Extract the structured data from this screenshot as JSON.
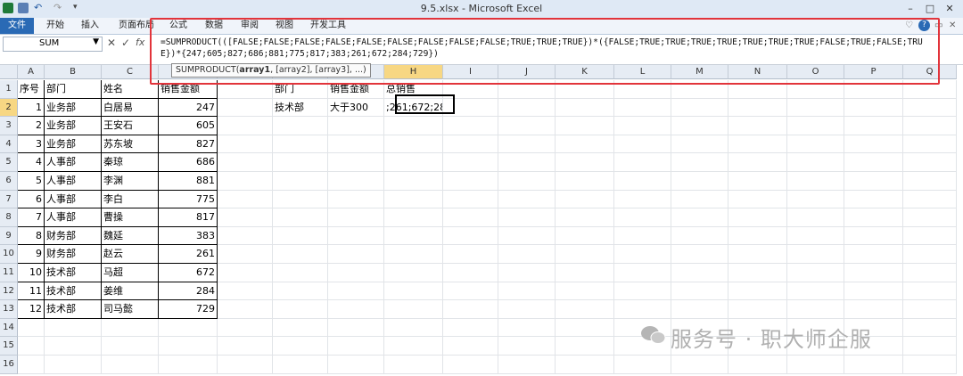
{
  "window": {
    "title": "9.5.xlsx - Microsoft Excel"
  },
  "ribbon": {
    "file_tab": "文件",
    "tabs": [
      "开始",
      "插入",
      "页面布局",
      "公式",
      "数据",
      "审阅",
      "视图",
      "开发工具"
    ]
  },
  "formula_bar": {
    "name_box": "SUM",
    "fx": "fx",
    "formula": "=SUMPRODUCT(([FALSE;FALSE;FALSE;FALSE;FALSE;FALSE;FALSE;FALSE;FALSE;TRUE;TRUE;TRUE})*({FALSE;TRUE;TRUE;TRUE;TRUE;TRUE;TRUE;TRUE;FALSE;TRUE;FALSE;TRUE})*{247;605;827;686;881;775;817;383;261;672;284;729})",
    "tooltip_func": "SUMPRODUCT(",
    "tooltip_arg1": "array1",
    "tooltip_rest": ", [array2], [array3], ...)"
  },
  "columns": [
    "A",
    "B",
    "C",
    "D",
    "E",
    "F",
    "G",
    "H",
    "I",
    "J",
    "K",
    "L",
    "M",
    "N",
    "O",
    "P",
    "Q"
  ],
  "rows": [
    "1",
    "2",
    "3",
    "4",
    "5",
    "6",
    "7",
    "8",
    "9",
    "10",
    "11",
    "12",
    "13",
    "14",
    "15",
    "16"
  ],
  "table": {
    "headers": [
      "序号",
      "部门",
      "姓名",
      "销售金额"
    ],
    "rows": [
      [
        "1",
        "业务部",
        "白居易",
        "247"
      ],
      [
        "2",
        "业务部",
        "王安石",
        "605"
      ],
      [
        "3",
        "业务部",
        "苏东坡",
        "827"
      ],
      [
        "4",
        "人事部",
        "秦琼",
        "686"
      ],
      [
        "5",
        "人事部",
        "李渊",
        "881"
      ],
      [
        "6",
        "人事部",
        "李白",
        "775"
      ],
      [
        "7",
        "人事部",
        "曹操",
        "817"
      ],
      [
        "8",
        "财务部",
        "魏延",
        "383"
      ],
      [
        "9",
        "财务部",
        "赵云",
        "261"
      ],
      [
        "10",
        "技术部",
        "马超",
        "672"
      ],
      [
        "11",
        "技术部",
        "姜维",
        "284"
      ],
      [
        "12",
        "技术部",
        "司马懿",
        "729"
      ]
    ]
  },
  "criteria": {
    "headers": [
      "部门",
      "销售金额",
      "总销售"
    ],
    "values": [
      "技术部",
      "大于300",
      ";261;672;28"
    ]
  },
  "watermark": "服务号 · 职大师企服",
  "colors": {
    "accent": "#2a6ab5",
    "annotation": "#e2343b"
  }
}
